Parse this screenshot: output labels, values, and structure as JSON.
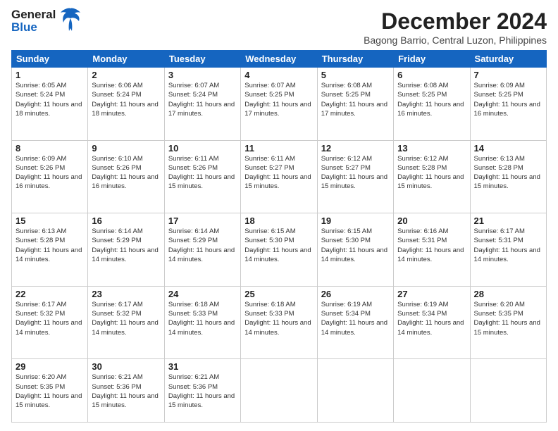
{
  "header": {
    "logo_line1": "General",
    "logo_line2": "Blue",
    "month": "December 2024",
    "location": "Bagong Barrio, Central Luzon, Philippines"
  },
  "days_of_week": [
    "Sunday",
    "Monday",
    "Tuesday",
    "Wednesday",
    "Thursday",
    "Friday",
    "Saturday"
  ],
  "weeks": [
    [
      {
        "day": 1,
        "sunrise": "6:05 AM",
        "sunset": "5:24 PM",
        "daylight": "11 hours and 18 minutes."
      },
      {
        "day": 2,
        "sunrise": "6:06 AM",
        "sunset": "5:24 PM",
        "daylight": "11 hours and 18 minutes."
      },
      {
        "day": 3,
        "sunrise": "6:07 AM",
        "sunset": "5:24 PM",
        "daylight": "11 hours and 17 minutes."
      },
      {
        "day": 4,
        "sunrise": "6:07 AM",
        "sunset": "5:25 PM",
        "daylight": "11 hours and 17 minutes."
      },
      {
        "day": 5,
        "sunrise": "6:08 AM",
        "sunset": "5:25 PM",
        "daylight": "11 hours and 17 minutes."
      },
      {
        "day": 6,
        "sunrise": "6:08 AM",
        "sunset": "5:25 PM",
        "daylight": "11 hours and 16 minutes."
      },
      {
        "day": 7,
        "sunrise": "6:09 AM",
        "sunset": "5:25 PM",
        "daylight": "11 hours and 16 minutes."
      }
    ],
    [
      {
        "day": 8,
        "sunrise": "6:09 AM",
        "sunset": "5:26 PM",
        "daylight": "11 hours and 16 minutes."
      },
      {
        "day": 9,
        "sunrise": "6:10 AM",
        "sunset": "5:26 PM",
        "daylight": "11 hours and 16 minutes."
      },
      {
        "day": 10,
        "sunrise": "6:11 AM",
        "sunset": "5:26 PM",
        "daylight": "11 hours and 15 minutes."
      },
      {
        "day": 11,
        "sunrise": "6:11 AM",
        "sunset": "5:27 PM",
        "daylight": "11 hours and 15 minutes."
      },
      {
        "day": 12,
        "sunrise": "6:12 AM",
        "sunset": "5:27 PM",
        "daylight": "11 hours and 15 minutes."
      },
      {
        "day": 13,
        "sunrise": "6:12 AM",
        "sunset": "5:28 PM",
        "daylight": "11 hours and 15 minutes."
      },
      {
        "day": 14,
        "sunrise": "6:13 AM",
        "sunset": "5:28 PM",
        "daylight": "11 hours and 15 minutes."
      }
    ],
    [
      {
        "day": 15,
        "sunrise": "6:13 AM",
        "sunset": "5:28 PM",
        "daylight": "11 hours and 14 minutes."
      },
      {
        "day": 16,
        "sunrise": "6:14 AM",
        "sunset": "5:29 PM",
        "daylight": "11 hours and 14 minutes."
      },
      {
        "day": 17,
        "sunrise": "6:14 AM",
        "sunset": "5:29 PM",
        "daylight": "11 hours and 14 minutes."
      },
      {
        "day": 18,
        "sunrise": "6:15 AM",
        "sunset": "5:30 PM",
        "daylight": "11 hours and 14 minutes."
      },
      {
        "day": 19,
        "sunrise": "6:15 AM",
        "sunset": "5:30 PM",
        "daylight": "11 hours and 14 minutes."
      },
      {
        "day": 20,
        "sunrise": "6:16 AM",
        "sunset": "5:31 PM",
        "daylight": "11 hours and 14 minutes."
      },
      {
        "day": 21,
        "sunrise": "6:17 AM",
        "sunset": "5:31 PM",
        "daylight": "11 hours and 14 minutes."
      }
    ],
    [
      {
        "day": 22,
        "sunrise": "6:17 AM",
        "sunset": "5:32 PM",
        "daylight": "11 hours and 14 minutes."
      },
      {
        "day": 23,
        "sunrise": "6:17 AM",
        "sunset": "5:32 PM",
        "daylight": "11 hours and 14 minutes."
      },
      {
        "day": 24,
        "sunrise": "6:18 AM",
        "sunset": "5:33 PM",
        "daylight": "11 hours and 14 minutes."
      },
      {
        "day": 25,
        "sunrise": "6:18 AM",
        "sunset": "5:33 PM",
        "daylight": "11 hours and 14 minutes."
      },
      {
        "day": 26,
        "sunrise": "6:19 AM",
        "sunset": "5:34 PM",
        "daylight": "11 hours and 14 minutes."
      },
      {
        "day": 27,
        "sunrise": "6:19 AM",
        "sunset": "5:34 PM",
        "daylight": "11 hours and 14 minutes."
      },
      {
        "day": 28,
        "sunrise": "6:20 AM",
        "sunset": "5:35 PM",
        "daylight": "11 hours and 15 minutes."
      }
    ],
    [
      {
        "day": 29,
        "sunrise": "6:20 AM",
        "sunset": "5:35 PM",
        "daylight": "11 hours and 15 minutes."
      },
      {
        "day": 30,
        "sunrise": "6:21 AM",
        "sunset": "5:36 PM",
        "daylight": "11 hours and 15 minutes."
      },
      {
        "day": 31,
        "sunrise": "6:21 AM",
        "sunset": "5:36 PM",
        "daylight": "11 hours and 15 minutes."
      },
      null,
      null,
      null,
      null
    ]
  ]
}
